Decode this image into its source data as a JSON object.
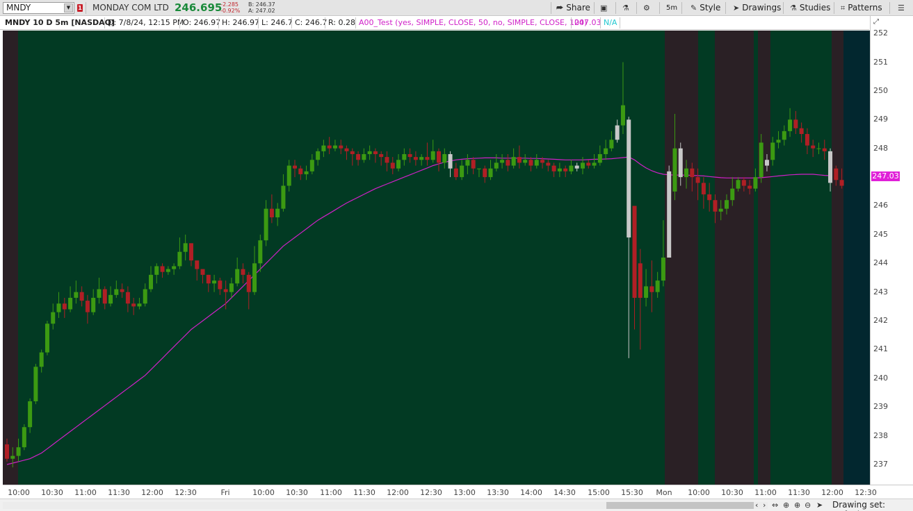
{
  "toolbar": {
    "symbol": "MNDY",
    "alert_badge": "1",
    "company": "MONDAY COM LTD",
    "last_price": "246.695",
    "net_change": "-2.285",
    "pct_change": "-0.92%",
    "bid": "B: 246.37",
    "ask": "A: 247.02",
    "share_label": "Share",
    "aggregation_label": "5m",
    "style_label": "Style",
    "drawings_label": "Drawings",
    "studies_label": "Studies",
    "patterns_label": "Patterns"
  },
  "infobar": {
    "title": "MNDY 10 D 5m [NASDAQ]",
    "date": "D: 7/8/24, 12:15 PM",
    "open": "O: 246.97",
    "high": "H: 246.97",
    "low": "L: 246.7",
    "close": "C: 246.7",
    "range": "R: 0.28",
    "study": "A00_Test (yes, SIMPLE, CLOSE, 50, no, SIMPLE, CLOSE, 100)",
    "study_value": "247.03",
    "study_na": "N/A"
  },
  "status": {
    "drawing_set": "Drawing set: Default"
  },
  "colors": {
    "background": "#023a23",
    "session_dark": "#2a2025",
    "future_area": "#02272f",
    "up_candle": "#3c9a12",
    "down_candle": "#b01f25",
    "neutral_candle": "#c8c8c8",
    "moving_average": "#d020c8",
    "price_tag": "#e020d8"
  },
  "chart_data": {
    "type": "candlestick",
    "symbol": "MNDY",
    "aggregation": "5m",
    "y_ticks": [
      252,
      251,
      250,
      249,
      248,
      247,
      246,
      245,
      244,
      243,
      242,
      241,
      240,
      239,
      238,
      237
    ],
    "ylim": [
      236.3,
      252.1
    ],
    "x_ticks": [
      "10:00",
      "10:30",
      "11:00",
      "11:30",
      "12:00",
      "12:30",
      "Fri",
      "10:00",
      "10:30",
      "11:00",
      "11:30",
      "12:00",
      "12:30",
      "13:00",
      "13:30",
      "14:00",
      "14:30",
      "15:00",
      "15:30",
      "Mon",
      "10:00",
      "10:30",
      "11:00",
      "11:30",
      "12:00",
      "12:30"
    ],
    "last_study_value": "247.03",
    "candles": [
      [
        237.7,
        237.2,
        237.9,
        237.1
      ],
      [
        237.2,
        237.3,
        237.6,
        236.9
      ],
      [
        237.3,
        237.6,
        237.9,
        237.1
      ],
      [
        237.6,
        238.3,
        238.4,
        237.5
      ],
      [
        238.3,
        239.2,
        239.3,
        238.1
      ],
      [
        239.2,
        240.4,
        240.5,
        239.1
      ],
      [
        240.4,
        240.9,
        241.0,
        240.2
      ],
      [
        240.9,
        241.9,
        242.0,
        240.8
      ],
      [
        241.9,
        242.3,
        242.6,
        241.7
      ],
      [
        242.3,
        242.6,
        243.0,
        242.1
      ],
      [
        242.6,
        242.4,
        242.8,
        242.1
      ],
      [
        242.4,
        242.8,
        243.2,
        242.3
      ],
      [
        242.8,
        243.0,
        243.4,
        242.6
      ],
      [
        243.0,
        242.7,
        243.2,
        242.5
      ],
      [
        242.7,
        242.3,
        242.9,
        241.9
      ],
      [
        242.3,
        242.8,
        243.1,
        242.2
      ],
      [
        242.8,
        243.1,
        243.5,
        242.6
      ],
      [
        243.1,
        242.6,
        243.2,
        242.4
      ],
      [
        242.6,
        242.9,
        243.2,
        242.5
      ],
      [
        242.9,
        243.1,
        243.4,
        242.8
      ],
      [
        243.1,
        243.0,
        243.3,
        242.8
      ],
      [
        243.0,
        242.6,
        243.2,
        242.3
      ],
      [
        242.6,
        242.5,
        242.8,
        242.2
      ],
      [
        242.5,
        242.6,
        242.8,
        242.4
      ],
      [
        242.6,
        243.1,
        243.3,
        242.5
      ],
      [
        243.1,
        243.6,
        243.9,
        243.0
      ],
      [
        243.6,
        243.9,
        244.0,
        243.3
      ],
      [
        243.9,
        243.7,
        244.0,
        243.5
      ],
      [
        243.7,
        243.8,
        243.9,
        243.6
      ],
      [
        243.8,
        243.9,
        244.0,
        243.6
      ],
      [
        243.9,
        244.4,
        244.9,
        243.8
      ],
      [
        244.4,
        244.7,
        245.0,
        244.1
      ],
      [
        244.7,
        244.1,
        244.3,
        243.9
      ],
      [
        244.1,
        243.8,
        244.0,
        243.4
      ],
      [
        243.8,
        243.6,
        243.8,
        243.3
      ],
      [
        243.6,
        243.3,
        243.6,
        243.0
      ],
      [
        243.3,
        243.4,
        243.6,
        243.0
      ],
      [
        243.4,
        243.1,
        243.5,
        242.9
      ],
      [
        243.1,
        243.0,
        243.4,
        242.4
      ],
      [
        243.0,
        243.3,
        243.5,
        242.8
      ],
      [
        243.3,
        243.8,
        244.2,
        243.2
      ],
      [
        243.8,
        243.6,
        244.0,
        243.3
      ],
      [
        243.6,
        243.0,
        243.7,
        242.4
      ],
      [
        243.0,
        244.0,
        244.6,
        242.9
      ],
      [
        244.0,
        244.8,
        245.0,
        243.7
      ],
      [
        244.8,
        245.9,
        246.2,
        244.6
      ],
      [
        245.9,
        245.6,
        246.4,
        245.4
      ],
      [
        245.6,
        245.9,
        246.1,
        245.3
      ],
      [
        245.9,
        246.7,
        247.1,
        245.8
      ],
      [
        246.7,
        247.4,
        247.6,
        246.5
      ],
      [
        247.4,
        247.3,
        247.6,
        247.0
      ],
      [
        247.3,
        247.1,
        247.4,
        246.9
      ],
      [
        247.1,
        247.2,
        247.4,
        246.9
      ],
      [
        247.2,
        247.6,
        247.8,
        247.1
      ],
      [
        247.6,
        247.9,
        248.0,
        247.4
      ],
      [
        247.9,
        248.1,
        248.3,
        247.7
      ],
      [
        248.1,
        248.0,
        248.4,
        247.8
      ],
      [
        248.0,
        248.1,
        248.3,
        247.9
      ],
      [
        248.1,
        248.0,
        248.3,
        247.8
      ],
      [
        248.0,
        247.9,
        248.1,
        247.6
      ],
      [
        247.9,
        247.8,
        248.0,
        247.4
      ],
      [
        247.8,
        247.6,
        247.9,
        247.4
      ],
      [
        247.6,
        247.8,
        248.0,
        247.5
      ],
      [
        247.8,
        247.9,
        248.1,
        247.6
      ],
      [
        247.9,
        247.8,
        248.0,
        247.5
      ],
      [
        247.8,
        247.7,
        247.9,
        247.4
      ],
      [
        247.7,
        247.5,
        247.9,
        247.2
      ],
      [
        247.5,
        247.3,
        247.7,
        247.1
      ],
      [
        247.3,
        247.6,
        247.8,
        247.2
      ],
      [
        247.6,
        247.8,
        248.0,
        247.4
      ],
      [
        247.8,
        247.7,
        248.0,
        247.5
      ],
      [
        247.7,
        247.6,
        247.9,
        247.4
      ],
      [
        247.6,
        247.7,
        247.8,
        247.4
      ],
      [
        247.7,
        247.6,
        248.2,
        247.4
      ],
      [
        247.6,
        247.9,
        248.3,
        247.5
      ],
      [
        247.9,
        247.5,
        248.0,
        247.2
      ],
      [
        247.5,
        247.8,
        248.0,
        247.3
      ],
      [
        247.8,
        247.3,
        247.9,
        247.0
      ],
      [
        247.3,
        247.0,
        247.5,
        246.9
      ],
      [
        247.0,
        247.4,
        247.6,
        246.9
      ],
      [
        247.4,
        247.6,
        247.8,
        247.1
      ],
      [
        247.6,
        247.3,
        247.7,
        247.1
      ],
      [
        247.3,
        247.3,
        247.3,
        247.0
      ],
      [
        247.3,
        247.0,
        247.4,
        246.8
      ],
      [
        247.0,
        247.3,
        247.6,
        246.9
      ],
      [
        247.3,
        247.5,
        247.8,
        247.2
      ],
      [
        247.5,
        247.6,
        247.8,
        247.3
      ],
      [
        247.6,
        247.4,
        247.8,
        247.2
      ],
      [
        247.4,
        247.7,
        248.0,
        247.3
      ],
      [
        247.7,
        247.5,
        248.1,
        247.3
      ],
      [
        247.5,
        247.6,
        247.8,
        247.4
      ],
      [
        247.6,
        247.4,
        247.7,
        247.2
      ],
      [
        247.4,
        247.6,
        247.8,
        247.3
      ],
      [
        247.6,
        247.5,
        247.7,
        247.3
      ],
      [
        247.5,
        247.4,
        247.6,
        247.2
      ],
      [
        247.4,
        247.2,
        247.5,
        247.0
      ],
      [
        247.2,
        247.3,
        247.5,
        247.0
      ],
      [
        247.3,
        247.2,
        247.4,
        247.0
      ],
      [
        247.2,
        247.4,
        247.6,
        247.1
      ],
      [
        247.4,
        247.3,
        247.5,
        247.2
      ],
      [
        247.3,
        247.5,
        247.7,
        247.1
      ],
      [
        247.5,
        247.4,
        247.6,
        247.3
      ],
      [
        247.4,
        247.5,
        247.8,
        247.3
      ],
      [
        247.5,
        247.8,
        248.1,
        247.4
      ],
      [
        247.8,
        248.0,
        248.3,
        247.6
      ],
      [
        248.0,
        248.3,
        248.6,
        247.9
      ],
      [
        248.3,
        248.8,
        249.0,
        248.2
      ],
      [
        248.8,
        249.5,
        251.0,
        248.5
      ],
      [
        249.0,
        244.9,
        249.1,
        240.7
      ],
      [
        246.0,
        242.8,
        246.0,
        241.7
      ],
      [
        244.0,
        242.8,
        244.5,
        241.0
      ],
      [
        242.8,
        243.2,
        243.8,
        242.5
      ],
      [
        243.2,
        243.0,
        244.1,
        242.3
      ],
      [
        243.0,
        243.4,
        243.7,
        242.8
      ],
      [
        243.4,
        244.2,
        245.5,
        243.2
      ],
      [
        244.2,
        247.2,
        247.4,
        244.2
      ],
      [
        246.5,
        248.0,
        249.2,
        246.2
      ],
      [
        248.0,
        247.0,
        248.2,
        246.7
      ],
      [
        247.0,
        247.3,
        247.6,
        246.6
      ],
      [
        247.3,
        247.0,
        247.5,
        246.5
      ],
      [
        247.0,
        246.8,
        247.3,
        246.2
      ],
      [
        246.8,
        246.4,
        247.0,
        245.9
      ],
      [
        246.4,
        246.2,
        246.8,
        245.8
      ],
      [
        246.2,
        245.8,
        246.4,
        245.4
      ],
      [
        245.8,
        245.9,
        246.2,
        245.5
      ],
      [
        245.9,
        246.2,
        246.4,
        245.7
      ],
      [
        246.2,
        246.6,
        247.0,
        246.0
      ],
      [
        246.6,
        246.9,
        247.0,
        246.5
      ],
      [
        246.9,
        246.7,
        247.0,
        246.5
      ],
      [
        246.7,
        246.6,
        246.9,
        246.4
      ],
      [
        246.6,
        247.0,
        247.3,
        246.5
      ],
      [
        247.0,
        248.2,
        248.5,
        246.8
      ],
      [
        247.4,
        247.6,
        247.8,
        247.2
      ],
      [
        247.6,
        248.2,
        248.4,
        247.4
      ],
      [
        248.2,
        248.3,
        248.6,
        248.0
      ],
      [
        248.3,
        248.6,
        248.8,
        248.1
      ],
      [
        248.6,
        249.0,
        249.4,
        248.4
      ],
      [
        249.0,
        248.7,
        249.3,
        248.5
      ],
      [
        248.7,
        248.5,
        248.9,
        248.2
      ],
      [
        248.5,
        248.1,
        248.7,
        247.8
      ],
      [
        248.1,
        248.0,
        248.3,
        247.7
      ],
      [
        248.0,
        248.0,
        248.2,
        247.8
      ],
      [
        248.0,
        247.9,
        248.3,
        247.6
      ],
      [
        247.9,
        246.8,
        248.0,
        246.5
      ],
      [
        247.3,
        246.9,
        247.4,
        246.7
      ],
      [
        246.9,
        246.7,
        247.3,
        246.6
      ]
    ],
    "ma": [
      237.0,
      237.05,
      237.1,
      237.15,
      237.2,
      237.3,
      237.4,
      237.55,
      237.7,
      237.85,
      238.0,
      238.15,
      238.3,
      238.45,
      238.6,
      238.75,
      238.9,
      239.05,
      239.2,
      239.35,
      239.5,
      239.65,
      239.8,
      239.95,
      240.1,
      240.3,
      240.5,
      240.7,
      240.9,
      241.1,
      241.3,
      241.5,
      241.7,
      241.85,
      242.0,
      242.15,
      242.3,
      242.45,
      242.6,
      242.8,
      243.0,
      243.2,
      243.4,
      243.6,
      243.8,
      244.0,
      244.2,
      244.4,
      244.6,
      244.75,
      244.9,
      245.05,
      245.2,
      245.35,
      245.5,
      245.62,
      245.74,
      245.86,
      245.98,
      246.1,
      246.2,
      246.3,
      246.4,
      246.5,
      246.6,
      246.68,
      246.76,
      246.84,
      246.92,
      247.0,
      247.08,
      247.16,
      247.24,
      247.32,
      247.4,
      247.46,
      247.52,
      247.56,
      247.6,
      247.62,
      247.64,
      247.65,
      247.66,
      247.67,
      247.67,
      247.67,
      247.66,
      247.66,
      247.66,
      247.66,
      247.66,
      247.65,
      247.65,
      247.64,
      247.63,
      247.62,
      247.61,
      247.6,
      247.6,
      247.6,
      247.6,
      247.61,
      247.62,
      247.62,
      247.63,
      247.64,
      247.66,
      247.68,
      247.7,
      247.6,
      247.45,
      247.32,
      247.22,
      247.15,
      247.1,
      247.08,
      247.07,
      247.07,
      247.07,
      247.06,
      247.05,
      247.04,
      247.02,
      247.0,
      246.98,
      246.97,
      246.97,
      246.97,
      246.97,
      246.97,
      246.97,
      246.98,
      247.0,
      247.02,
      247.04,
      247.06,
      247.08,
      247.09,
      247.1,
      247.1,
      247.1,
      247.08,
      247.06,
      247.05
    ]
  }
}
